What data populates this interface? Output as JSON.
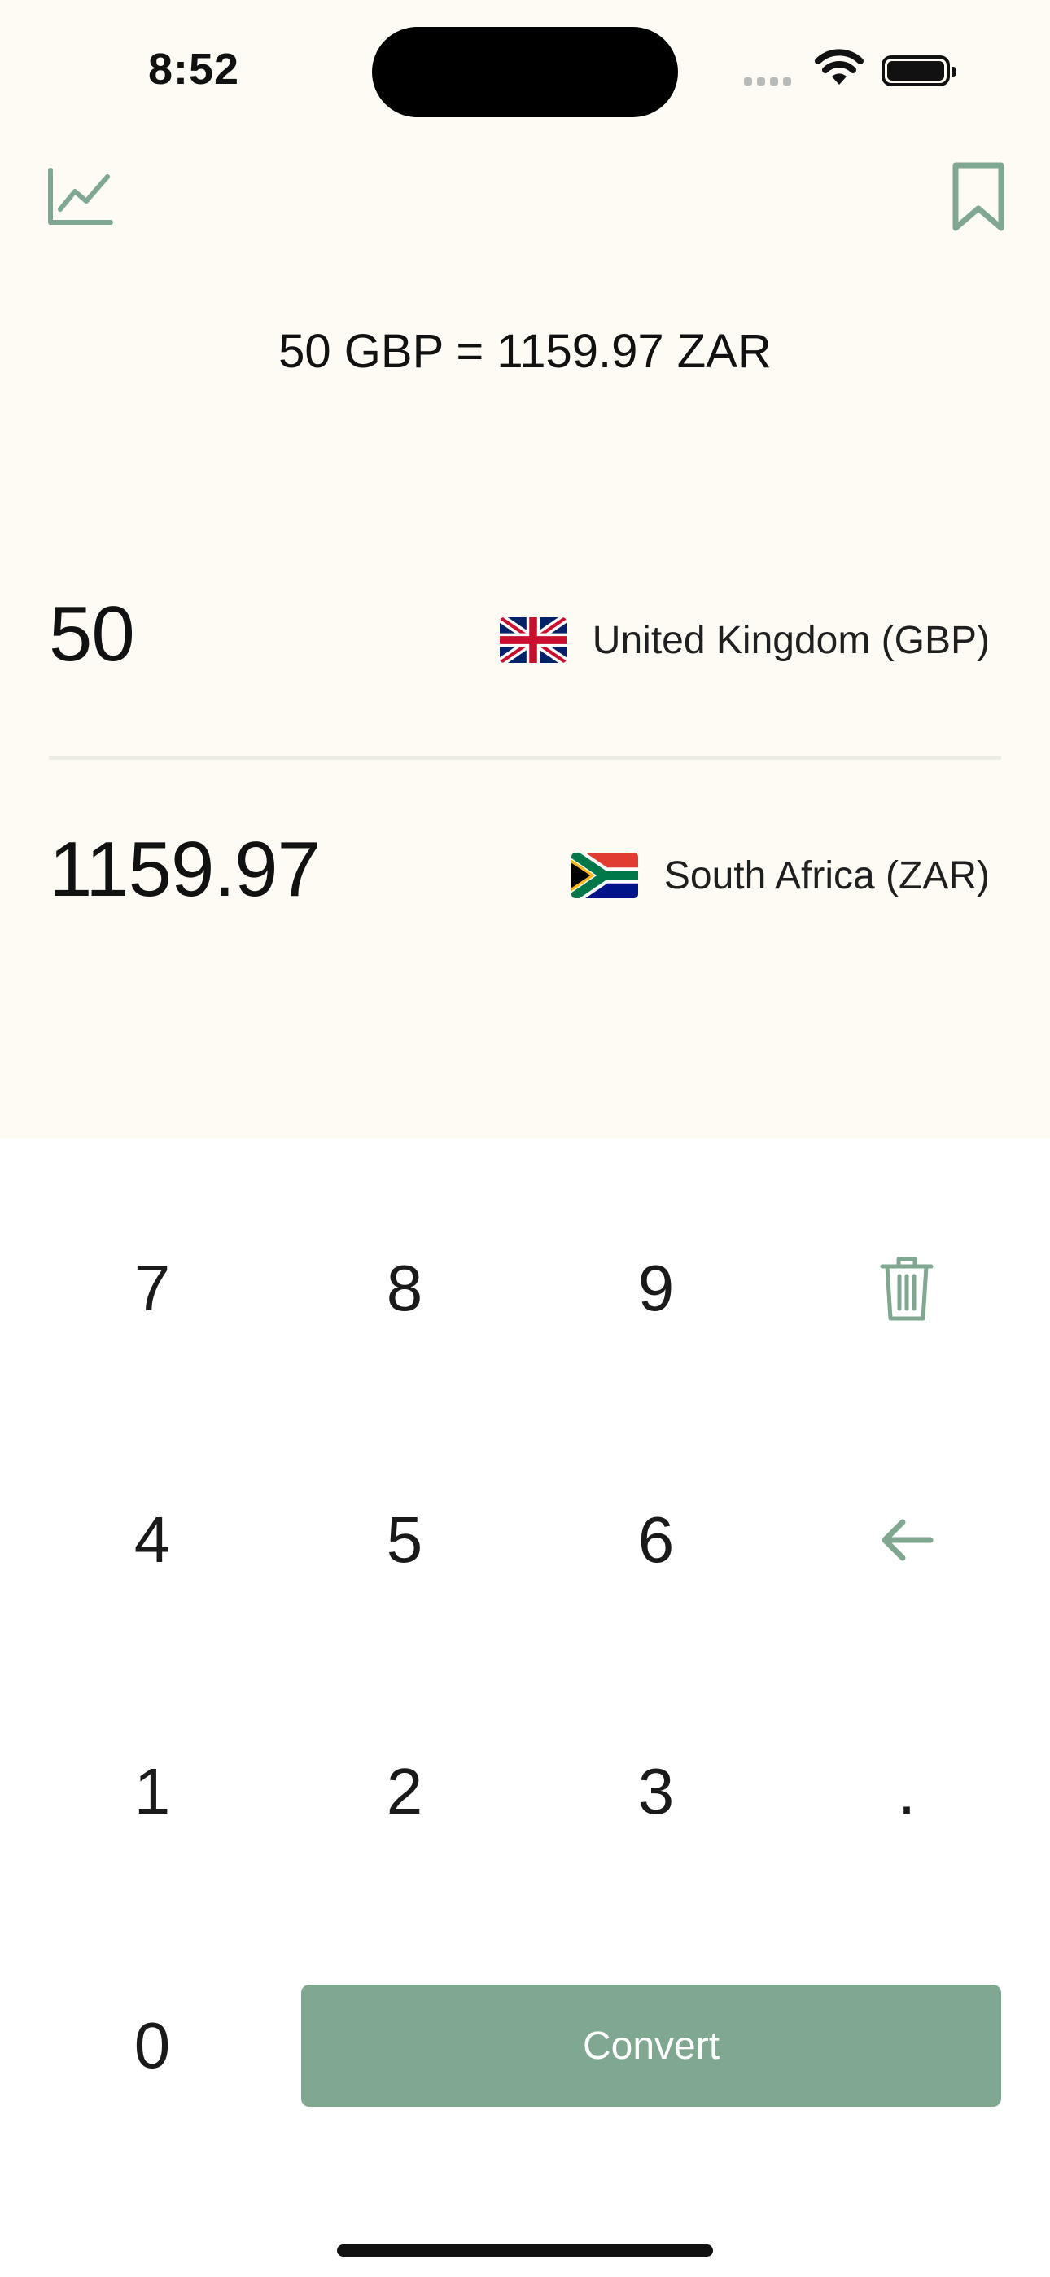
{
  "status_bar": {
    "time": "8:52"
  },
  "toolbar": {
    "chart_icon": "line-chart-icon",
    "bookmark_icon": "bookmark-icon"
  },
  "conversion": {
    "rate_text": "50 GBP = 1159.97 ZAR",
    "from": {
      "amount": "50",
      "currency_label": "United Kingdom (GBP)",
      "flag": "uk-flag-icon"
    },
    "to": {
      "amount": "1159.97",
      "currency_label": "South Africa (ZAR)",
      "flag": "za-flag-icon"
    }
  },
  "keypad": {
    "keys": [
      "7",
      "8",
      "9",
      "4",
      "5",
      "6",
      "1",
      "2",
      "3",
      ".",
      "0"
    ],
    "clear_icon": "trash-icon",
    "backspace_icon": "arrow-left-icon",
    "convert_label": "Convert"
  },
  "colors": {
    "accent": "#80a790",
    "top_background": "#fdfbf3",
    "keypad_background": "#ffffff",
    "text": "#111111"
  }
}
